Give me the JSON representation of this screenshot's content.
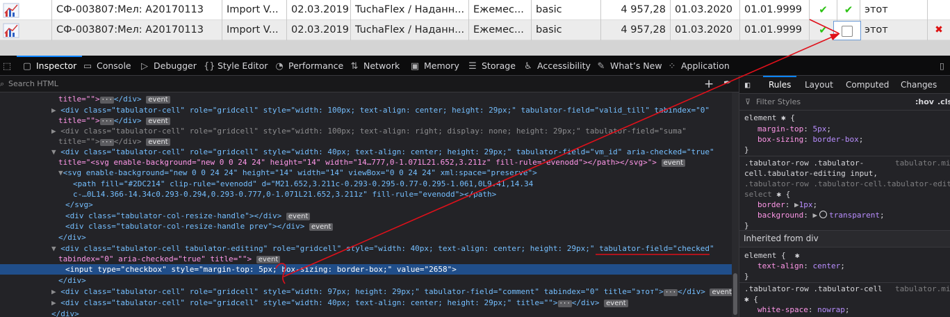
{
  "table": {
    "rows": [
      {
        "name": "СФ-003807:Мел: А20170113",
        "import": "Import V...",
        "date": "02.03.2019",
        "client": "TuchaFlex / Наданн...",
        "period": "Ежемес...",
        "tariff": "basic",
        "sum": "4 957,28",
        "from": "01.03.2020",
        "till": "01.01.9999",
        "comment": "этот"
      },
      {
        "name": "СФ-003807:Мел: А20170113",
        "import": "Import V...",
        "date": "02.03.2019",
        "client": "TuchaFlex / Наданн...",
        "period": "Ежемес...",
        "tariff": "basic",
        "sum": "4 957,28",
        "from": "01.03.2020",
        "till": "01.01.9999",
        "comment": "этот"
      }
    ],
    "check_mark": "✔",
    "delete_mark": "✖"
  },
  "devtools": {
    "tabs": [
      {
        "label": "Inspector",
        "icon": "inspector-icon"
      },
      {
        "label": "Console",
        "icon": "console-icon"
      },
      {
        "label": "Debugger",
        "icon": "debugger-icon"
      },
      {
        "label": "Style Editor",
        "icon": "style-editor-icon"
      },
      {
        "label": "Performance",
        "icon": "performance-icon"
      },
      {
        "label": "Network",
        "icon": "network-icon"
      },
      {
        "label": "Memory",
        "icon": "memory-icon"
      },
      {
        "label": "Storage",
        "icon": "storage-icon"
      },
      {
        "label": "Accessibility",
        "icon": "accessibility-icon"
      },
      {
        "label": "What’s New",
        "icon": "whats-new-icon"
      },
      {
        "label": "Application",
        "icon": "application-icon"
      }
    ],
    "search_placeholder": "Search HTML",
    "event_badge": "event",
    "markup": {
      "l0": "title=\"\">",
      "l0b": "</div>",
      "l1a": "<div class=\"tabulator-cell\" role=\"gridcell\" style=\"width: 100px; text-align: center; height: 29px;\" tabulator-field=\"valid_till\" tabindex=\"0\"",
      "l1b": "title=\"\">",
      "l1c": "</div>",
      "l2a": "<div class=\"tabulator-cell\" role=\"gridcell\" style=\"width: 100px; text-align: right; display: none; height: 29px;\" tabulator-field=\"suma\"",
      "l2b": "title=\"\">",
      "l2c": "</div>",
      "l3a": "<div class=\"tabulator-cell\" role=\"gridcell\" style=\"width: 40px; text-align: center; height: 29px;\" tabulator-field=\"vm_id\" aria-checked=\"true\"",
      "l3b": "title=\"<svg enable-background=\"new 0 0 24 24\" height=\"14\" width=\"14…777,0-1.071L21.652,3.211z\" fill-rule=\"evenodd\"></path></svg>\">",
      "l4": "<svg enable-background=\"new 0 0 24 24\" height=\"14\" width=\"14\" viewBox=\"0 0 24 24\" xml:space=\"preserve\">",
      "l5a": "<path fill=\"#2DC214\" clip-rule=\"evenodd\" d=\"M21.652,3.211c-0.293-0.295-0.77-0.295-1.061,0L9.41,14.34",
      "l5b": "c-…0L14.366-14.34c0.293-0.294,0.293-0.777,0-1.071L21.652,3.211z\" fill-rule=\"evenodd\"></path>",
      "l6": "</svg>",
      "l7": "<div class=\"tabulator-col-resize-handle\"></div>",
      "l8": "<div class=\"tabulator-col-resize-handle prev\"></div>",
      "l9": "</div>",
      "l10a": "<div class=\"tabulator-cell tabulator-editing\" role=\"gridcell\" style=\"width: 40px; text-align: center; height: 29px;\" tabulator-field=\"checked\"",
      "l10b": "tabindex=\"0\" aria-checked=\"true\" title=\"\">",
      "l11": "<input type=\"checkbox\" style=\"margin-top: 5px; box-sizing: border-box;\" value=\"2658\">",
      "l12": "</div>",
      "l13a": "<div class=\"tabulator-cell\" role=\"gridcell\" style=\"width: 97px; height: 29px;\" tabulator-field=\"comment\" tabindex=\"0\" title=\"этот\">",
      "l13b": "</div>",
      "l14a": "<div class=\"tabulator-cell\" role=\"gridcell\" style=\"width: 40px; text-align: center; height: 29px;\" title=\"\">",
      "l14b": "</div>",
      "l15": "</div>"
    },
    "rules": {
      "tabs": [
        "Rules",
        "Layout",
        "Computed",
        "Changes"
      ],
      "filter_placeholder": "Filter Styles",
      "hov": ":hov",
      "cls": ".cls",
      "r1_selector": "element",
      "r1_props": [
        [
          "margin-top",
          "5px"
        ],
        [
          "box-sizing",
          "border-box"
        ]
      ],
      "r2_sel1": ".tabulator-row .tabulator-",
      "r2_sel2": "cell.tabulator-editing input,",
      "r2_sel3": ".tabulator-row .tabulator-cell.tabulator-editing",
      "r2_sel4": "select",
      "r2_src": "tabulator.mi",
      "r2_props": [
        [
          "border",
          "1px"
        ],
        [
          "background",
          "transparent"
        ]
      ],
      "inherited": "Inherited from div",
      "r3_selector": "element",
      "r3_props": [
        [
          "text-align",
          "center"
        ]
      ],
      "r4_selector": ".tabulator-row .tabulator-cell",
      "r4_src": "tabulator.mi",
      "r4_props": [
        [
          "white-space",
          "nowrap"
        ]
      ]
    }
  }
}
